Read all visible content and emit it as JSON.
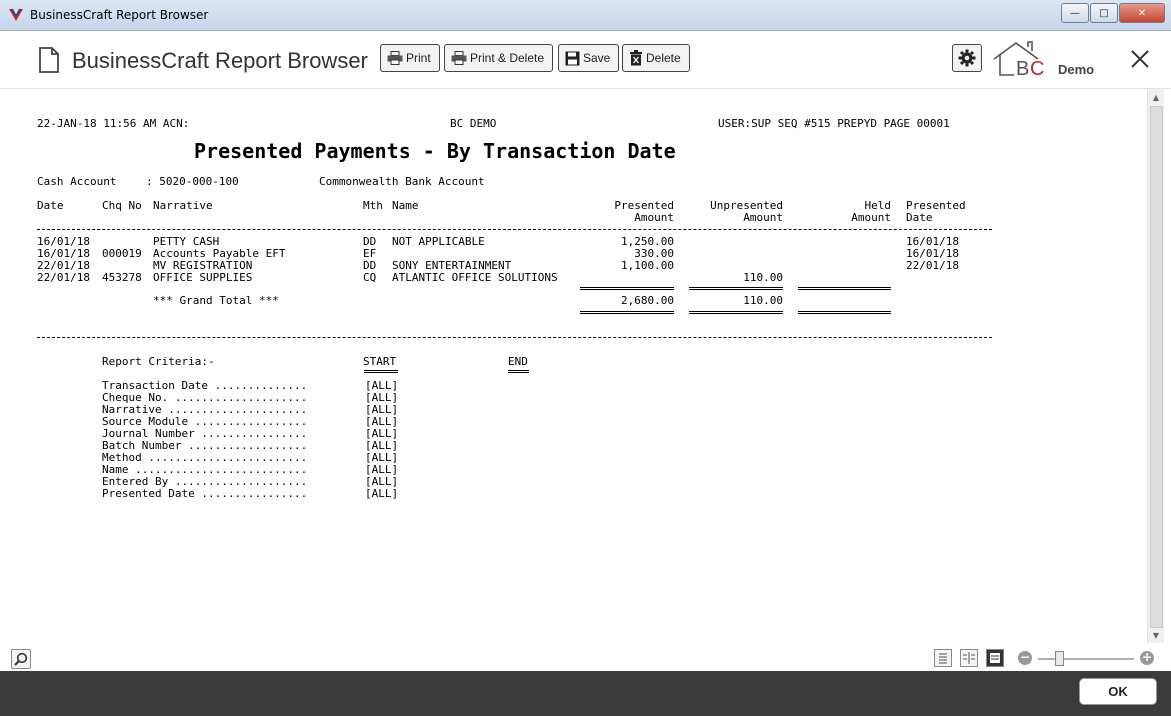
{
  "window": {
    "title": "BusinessCraft Report Browser",
    "buttons": [
      "minimize",
      "maximize",
      "close"
    ]
  },
  "toolbar": {
    "app_title": "BusinessCraft Report Browser",
    "print_label": "Print",
    "print_delete_label": "Print & Delete",
    "save_label": "Save",
    "delete_label": "Delete",
    "logo_text": "BC",
    "demo_label": "Demo"
  },
  "report": {
    "header_left": "22-JAN-18 11:56 AM ACN:",
    "header_center": "BC DEMO",
    "header_right": "USER:SUP SEQ #515 PREPYD PAGE 00001",
    "title": "Presented Payments - By Transaction Date",
    "cash_account_label": "Cash Account",
    "cash_account_value": ": 5020-000-100",
    "cash_account_name": "Commonwealth Bank Account",
    "columns": {
      "date": "Date",
      "chq_no": "Chq No",
      "narrative": "Narrative",
      "mth": "Mth",
      "name": "Name",
      "presented_1": "Presented",
      "presented_2": "Amount",
      "unpresented_1": "Unpresented",
      "unpresented_2": "Amount",
      "held_1": "Held",
      "held_2": "Amount",
      "pdate_1": "Presented",
      "pdate_2": "Date"
    },
    "rows": [
      {
        "date": "16/01/18",
        "chq": "",
        "narrative": "PETTY CASH",
        "mth": "DD",
        "name": "NOT APPLICABLE",
        "presented": "1,250.00",
        "unpresented": "",
        "held": "",
        "pdate": "16/01/18"
      },
      {
        "date": "16/01/18",
        "chq": "000019",
        "narrative": "Accounts Payable EFT",
        "mth": "EF",
        "name": "",
        "presented": "330.00",
        "unpresented": "",
        "held": "",
        "pdate": "16/01/18"
      },
      {
        "date": "22/01/18",
        "chq": "",
        "narrative": "MV REGISTRATION",
        "mth": "DD",
        "name": "SONY ENTERTAINMENT",
        "presented": "1,100.00",
        "unpresented": "",
        "held": "",
        "pdate": "22/01/18"
      },
      {
        "date": "22/01/18",
        "chq": "453278",
        "narrative": "OFFICE SUPPLIES",
        "mth": "CQ",
        "name": "ATLANTIC OFFICE SOLUTIONS",
        "presented": "",
        "unpresented": "110.00",
        "held": "",
        "pdate": ""
      }
    ],
    "grand_total_label": "*** Grand Total ***",
    "grand_total_presented": "2,680.00",
    "grand_total_unpresented": "110.00",
    "criteria_heading": "Report Criteria:-",
    "start_label": "START",
    "end_label": "END",
    "criteria": [
      {
        "label": "Transaction Date ..............",
        "start": "[ALL]"
      },
      {
        "label": "Cheque No. ....................",
        "start": "[ALL]"
      },
      {
        "label": "Narrative .....................",
        "start": "[ALL]"
      },
      {
        "label": "Source Module .................",
        "start": "[ALL]"
      },
      {
        "label": "Journal Number ................",
        "start": "[ALL]"
      },
      {
        "label": "Batch Number ..................",
        "start": "[ALL]"
      },
      {
        "label": "Method ........................",
        "start": "[ALL]"
      },
      {
        "label": "Name ..........................",
        "start": "[ALL]"
      },
      {
        "label": "Entered By ....................",
        "start": "[ALL]"
      },
      {
        "label": "Presented Date ................",
        "start": "[ALL]"
      }
    ]
  },
  "footer": {
    "ok_label": "OK"
  }
}
